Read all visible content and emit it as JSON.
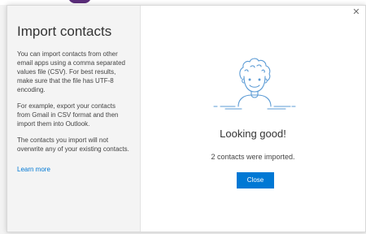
{
  "dialog": {
    "left": {
      "title": "Import contacts",
      "paragraphs": [
        "You can import contacts from other email apps using a comma separated values file (CSV). For best results, make sure that the file has UTF-8 encoding.",
        "For example, export your contacts from Gmail in CSV format and then import them into Outlook.",
        "The contacts you import will not overwrite any of your existing contacts."
      ],
      "learn_more": "Learn more"
    },
    "right": {
      "close_glyph": "✕",
      "status_title": "Looking good!",
      "status_text": "2 contacts were imported.",
      "close_button": "Close"
    }
  },
  "icons": {
    "illustration": "person-illustration-icon",
    "close": "close-icon"
  },
  "colors": {
    "accent": "#0078d4",
    "illustration_stroke": "#5b9bd5",
    "brand_tab": "#5b2d7a"
  }
}
